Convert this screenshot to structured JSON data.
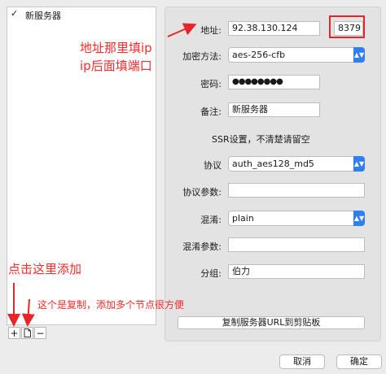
{
  "server_list": {
    "items": [
      {
        "label": "新服务器",
        "checked": true
      }
    ]
  },
  "toolbar": {
    "add": "+",
    "copy_icon": "copy-document-icon",
    "remove": "−"
  },
  "form": {
    "address_label": "地址:",
    "address_value": "92.38.130.124",
    "port_value": "8379",
    "encryption_label": "加密方法:",
    "encryption_value": "aes-256-cfb",
    "password_label": "密码:",
    "password_value": "●●●●●●●●",
    "remark_label": "备注:",
    "remark_value": "新服务器",
    "ssr_note": "SSR设置，不清楚请留空",
    "protocol_label": "协议",
    "protocol_value": "auth_aes128_md5",
    "protocol_param_label": "协议参数:",
    "protocol_param_value": "",
    "obfs_label": "混淆:",
    "obfs_value": "plain",
    "obfs_param_label": "混淆参数:",
    "obfs_param_value": "",
    "group_label": "分组:",
    "group_value": "伯力",
    "copy_url_label": "复制服务器URL到剪贴板"
  },
  "footer": {
    "cancel": "取消",
    "ok": "确定"
  },
  "annotations": {
    "address_note_line1": "地址那里填ip",
    "address_note_line2": "ip后面填端口",
    "add_note": "点击这里添加",
    "copy_note": "这个是复制，添加多个节点很方便",
    "color": "#ff2a2a"
  },
  "colors": {
    "accent": "#2f7ff2",
    "annotation": "#ff2a2a",
    "highlight_border": "#e8232a"
  }
}
